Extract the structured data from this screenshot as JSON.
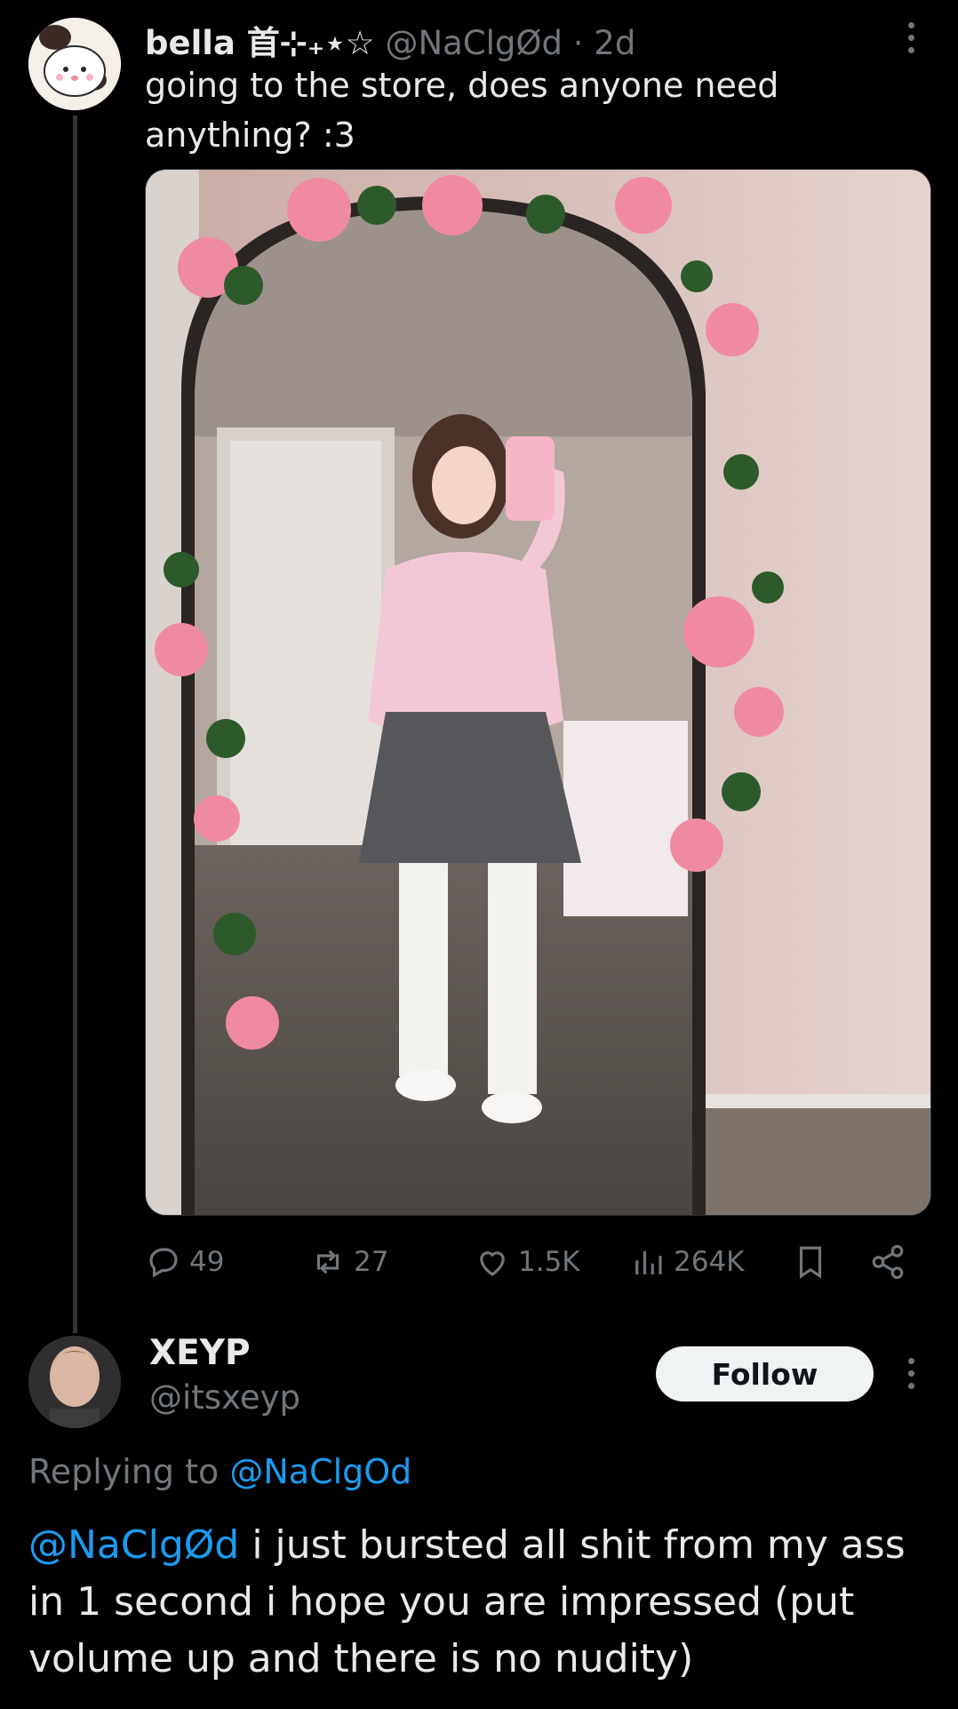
{
  "tweet": {
    "display_name": "bella ⾸⊹₊⋆☆",
    "handle": "@NaClgØd",
    "separator": "·",
    "time": "2d",
    "text": "going to the store, does anyone need anything? :3",
    "media_icon": "mirror-selfie-photo"
  },
  "actions": {
    "replies": "49",
    "reposts": "27",
    "likes": "1.5K",
    "views": "264K",
    "icons": [
      "reply-icon",
      "repost-icon",
      "like-icon",
      "views-icon",
      "bookmark-icon",
      "share-icon"
    ]
  },
  "reply": {
    "display_name": "XEYP",
    "handle": "@itsxeyp",
    "follow_label": "Follow",
    "replying_to_label": "Replying to",
    "replying_to_handle": "@NaClgOd",
    "mention": "@NaClgØd",
    "text": " i just bursted all shit from my ass in 1 second i hope you are impressed (put volume up and there is no nudity)"
  },
  "colors": {
    "background": "#000000",
    "text_primary": "#e7e9ea",
    "text_secondary": "#71767b",
    "link": "#1d9bf0",
    "follow_button_bg": "#eff3f4"
  }
}
